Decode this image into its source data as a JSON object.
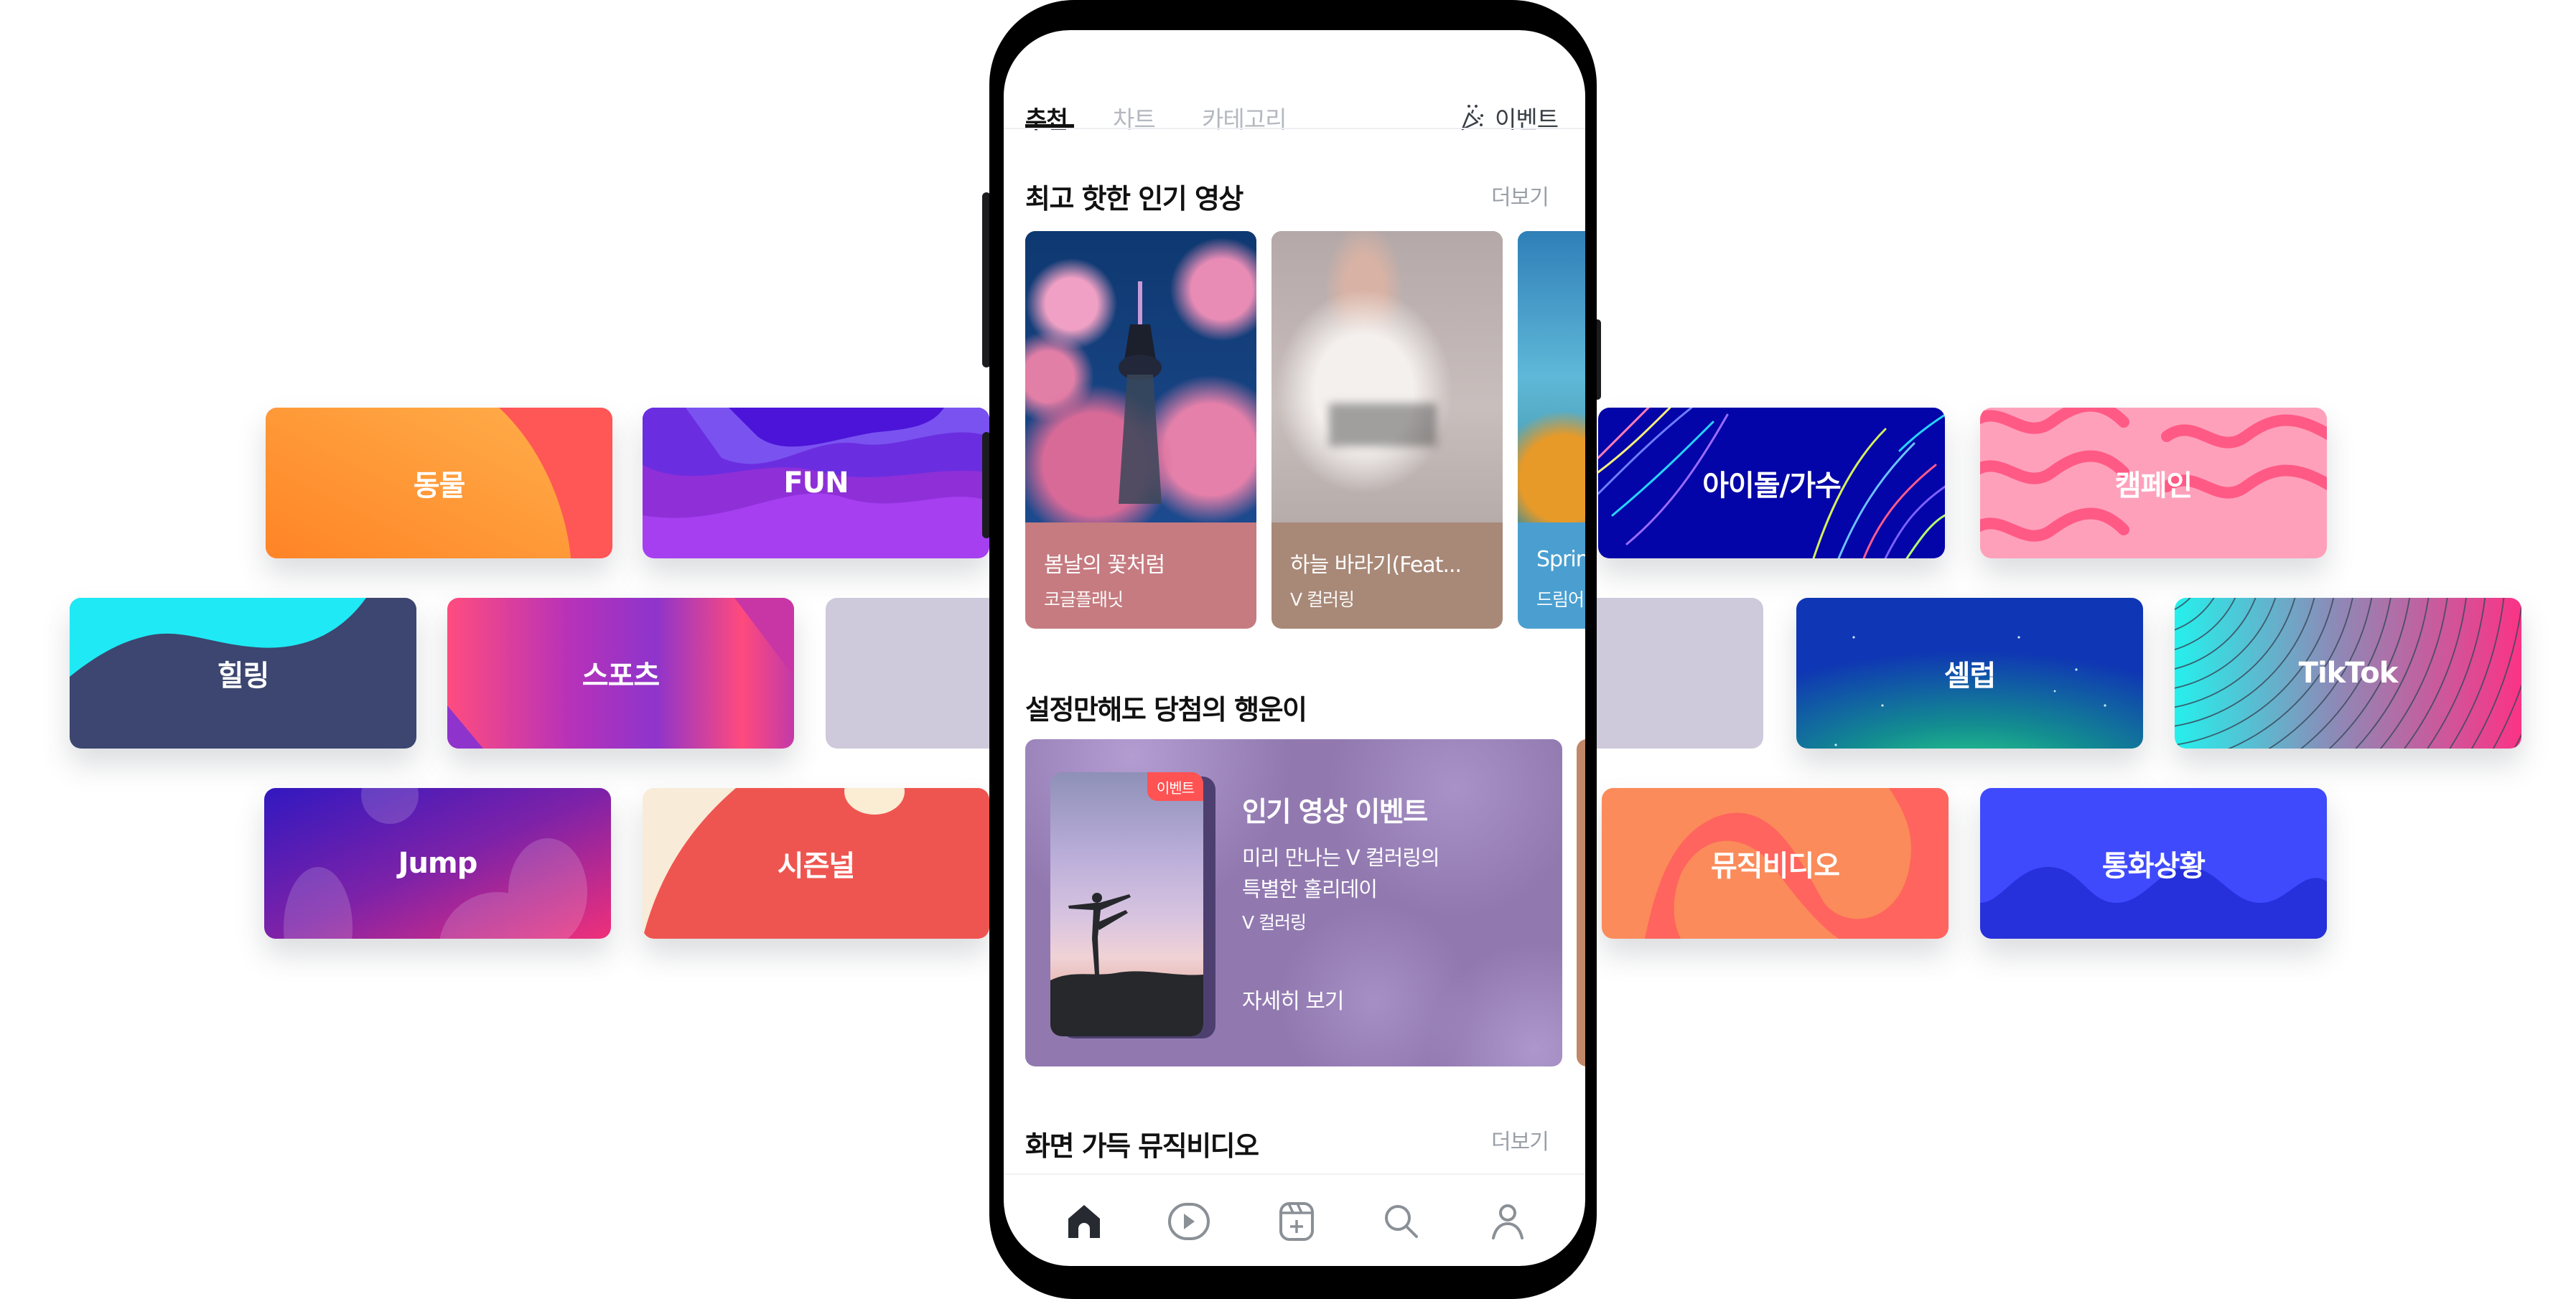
{
  "colors": {
    "background": "#ffffff",
    "text_primary": "#111111",
    "text_inactive": "#b4b8c0",
    "more_link": "#9aa0a8",
    "event_badge": "#ff5252",
    "event_card_bg": "#9179b0"
  },
  "categories": [
    {
      "label": "동물",
      "theme": "orange-sun"
    },
    {
      "label": "FUN",
      "theme": "purple-waves"
    },
    {
      "label": "아이돌/가수",
      "theme": "navy-neon-lines"
    },
    {
      "label": "캠페인",
      "theme": "pink-squiggles"
    },
    {
      "label": "힐링",
      "theme": "cyan-navy-wave"
    },
    {
      "label": "스포츠",
      "theme": "pink-purple-stripes"
    },
    {
      "label": "",
      "theme": "placeholder-grey"
    },
    {
      "label": "",
      "theme": "placeholder-grey"
    },
    {
      "label": "셀럽",
      "theme": "night-sky-aurora"
    },
    {
      "label": "TikTok",
      "theme": "cyan-pink-arcs"
    },
    {
      "label": "Jump",
      "theme": "violet-bubbles"
    },
    {
      "label": "시즌널",
      "theme": "red-cream"
    },
    {
      "label": "뮤직비디오",
      "theme": "orange-swirl"
    },
    {
      "label": "통화상황",
      "theme": "blue-waves"
    }
  ],
  "app": {
    "tabs": [
      {
        "label": "추천",
        "active": true
      },
      {
        "label": "차트",
        "active": false
      },
      {
        "label": "카테고리",
        "active": false
      }
    ],
    "event_tab": {
      "label": "이벤트",
      "icon": "party-popper-icon"
    },
    "sections": [
      {
        "title": "최고 핫한 인기 영상",
        "more": "더보기"
      },
      {
        "title": "설정만해도 당첨의 행운이",
        "more": ""
      },
      {
        "title": "화면 가득 뮤직비디오",
        "more": "더보기"
      }
    ],
    "videos": [
      {
        "title": "봄날의 꽃처럼",
        "artist": "코글플래닛",
        "caption_color": "#c57b80"
      },
      {
        "title": "하늘 바라기(Feat...",
        "artist": "V 컬러링",
        "caption_color": "#a88877"
      },
      {
        "title": "Spring",
        "artist": "드림어",
        "caption_color": "#4a9fd0"
      }
    ],
    "event": {
      "badge": "이벤트",
      "title": "인기 영상 이벤트",
      "desc_line1": "미리 만나는 V 컬러링의",
      "desc_line2": "특별한 홀리데이",
      "artist": "V 컬러링",
      "cta": "자세히 보기"
    },
    "bottom_nav": [
      {
        "name": "home",
        "icon": "home-icon",
        "active": true
      },
      {
        "name": "video",
        "icon": "play-icon",
        "active": false
      },
      {
        "name": "create",
        "icon": "add-clip-icon",
        "active": false
      },
      {
        "name": "search",
        "icon": "search-icon",
        "active": false
      },
      {
        "name": "my",
        "icon": "person-icon",
        "active": false
      }
    ]
  }
}
